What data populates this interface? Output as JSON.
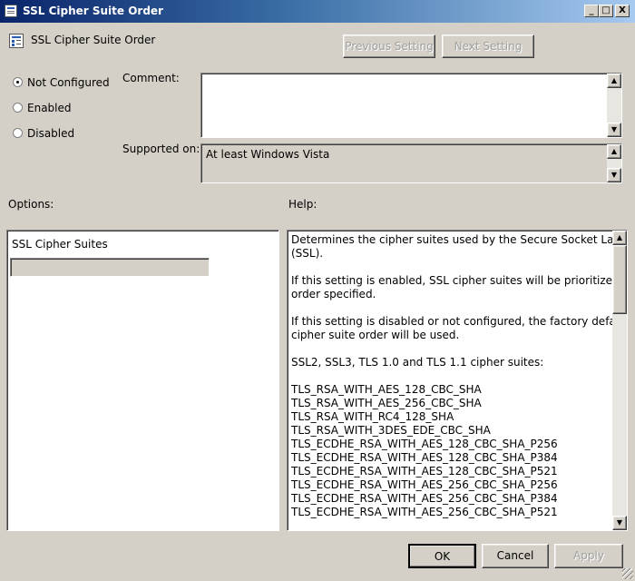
{
  "window": {
    "title": "SSL Cipher Suite Order",
    "minimize": "_",
    "maximize": "□",
    "close": "X"
  },
  "header": {
    "policy_name": "SSL Cipher Suite Order",
    "prev_button": "Previous Setting",
    "next_button": "Next Setting"
  },
  "state": {
    "options": [
      "Not Configured",
      "Enabled",
      "Disabled"
    ],
    "selected": "Not Configured"
  },
  "comment": {
    "label": "Comment:",
    "value": ""
  },
  "supported": {
    "label": "Supported on:",
    "value": "At least Windows Vista"
  },
  "options_panel": {
    "label": "Options:",
    "field_label": "SSL Cipher Suites",
    "field_value": ""
  },
  "help_panel": {
    "label": "Help:",
    "paragraphs": [
      [
        "Determines the cipher suites used by the Secure Socket Layer",
        "(SSL)."
      ],
      [
        "If this setting is enabled, SSL cipher suites will be prioritized in the",
        "order specified."
      ],
      [
        "If this setting is disabled or not configured, the factory default",
        "cipher suite order will be used."
      ],
      [
        "SSL2, SSL3, TLS 1.0 and TLS 1.1 cipher suites:"
      ]
    ],
    "cipher_suites": [
      "TLS_RSA_WITH_AES_128_CBC_SHA",
      "TLS_RSA_WITH_AES_256_CBC_SHA",
      "TLS_RSA_WITH_RC4_128_SHA",
      "TLS_RSA_WITH_3DES_EDE_CBC_SHA",
      "TLS_ECDHE_RSA_WITH_AES_128_CBC_SHA_P256",
      "TLS_ECDHE_RSA_WITH_AES_128_CBC_SHA_P384",
      "TLS_ECDHE_RSA_WITH_AES_128_CBC_SHA_P521",
      "TLS_ECDHE_RSA_WITH_AES_256_CBC_SHA_P256",
      "TLS_ECDHE_RSA_WITH_AES_256_CBC_SHA_P384",
      "TLS_ECDHE_RSA_WITH_AES_256_CBC_SHA_P521"
    ]
  },
  "footer": {
    "ok": "OK",
    "cancel": "Cancel",
    "apply": "Apply"
  },
  "colors": {
    "dialog_bg": "#d4d0c8",
    "title_start": "#0a246a",
    "title_end": "#a6caf0",
    "disabled_text": "#a0a0a0"
  }
}
